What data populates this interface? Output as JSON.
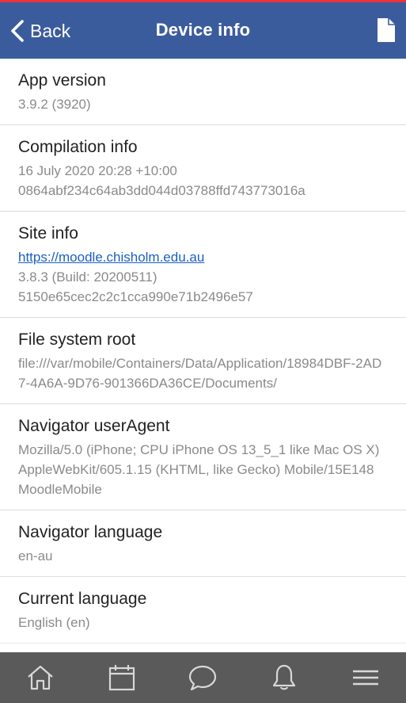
{
  "header": {
    "back_label": "Back",
    "title": "Device info",
    "back_icon": "chevron-left-icon",
    "action_icon": "document-icon"
  },
  "items": [
    {
      "heading": "App version",
      "lines": [
        "3.9.2 (3920)"
      ]
    },
    {
      "heading": "Compilation info",
      "lines": [
        "16 July 2020 20:28 +10:00",
        "0864abf234c64ab3dd044d03788ffd743773016a"
      ]
    },
    {
      "heading": "Site info",
      "link": "https://moodle.chisholm.edu.au",
      "lines": [
        "3.8.3 (Build: 20200511)",
        "5150e65cec2c2c1cca990e71b2496e57"
      ]
    },
    {
      "heading": "File system root",
      "lines": [
        "file:///var/mobile/Containers/Data/Application/18984DBF-2AD7-4A6A-9D76-901366DA36CE/Documents/"
      ]
    },
    {
      "heading": "Navigator userAgent",
      "lines": [
        "Mozilla/5.0 (iPhone; CPU iPhone OS 13_5_1 like Mac OS X) AppleWebKit/605.1.15 (KHTML, like Gecko) Mobile/15E148 MoodleMobile"
      ]
    },
    {
      "heading": "Navigator language",
      "lines": [
        "en-au"
      ]
    },
    {
      "heading": "Current language",
      "lines": [
        "English (en)"
      ]
    }
  ],
  "tabbar": {
    "icons": [
      "home-icon",
      "calendar-icon",
      "messages-icon",
      "notifications-icon",
      "menu-icon"
    ]
  },
  "colors": {
    "header_bg": "#3b5c9c",
    "accent_line": "#e8343b",
    "tabbar_bg": "#5a5a5a",
    "link": "#1a5fc4",
    "secondary_text": "#8a8a8a"
  }
}
